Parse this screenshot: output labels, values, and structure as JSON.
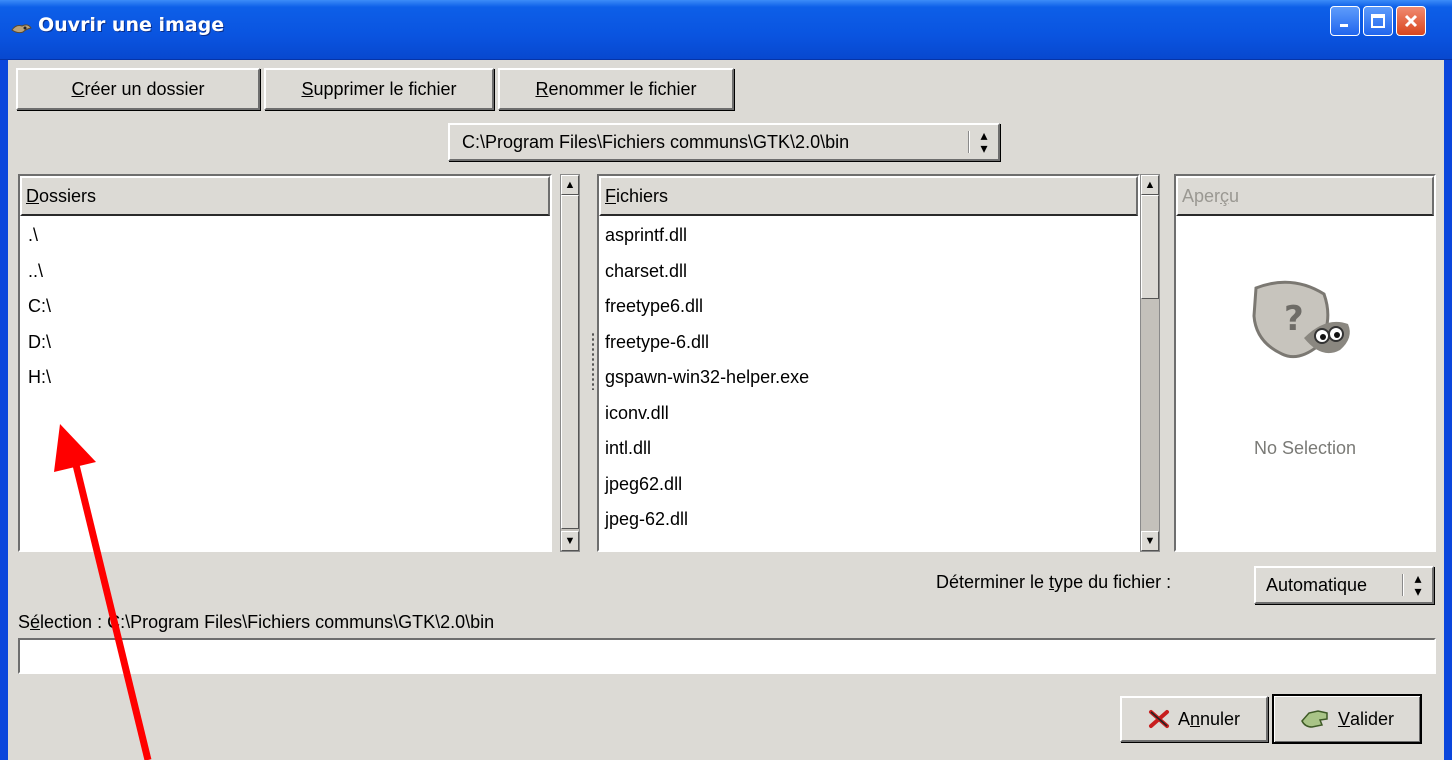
{
  "window": {
    "title": "Ouvrir une image"
  },
  "toolbar": {
    "create_folder_prefix": "",
    "create_folder_mnemonic": "C",
    "create_folder_rest": "réer un dossier",
    "delete_file_mnemonic": "S",
    "delete_file_rest": "upprimer le fichier",
    "rename_file_mnemonic": "R",
    "rename_file_rest": "enommer le fichier"
  },
  "path": {
    "current": "C:\\Program Files\\Fichiers communs\\GTK\\2.0\\bin"
  },
  "folders": {
    "header_mnemonic": "D",
    "header_rest": "ossiers",
    "items": [
      ".\\",
      "..\\",
      "C:\\",
      "D:\\",
      "H:\\"
    ]
  },
  "files": {
    "header_mnemonic": "F",
    "header_rest": "ichiers",
    "items": [
      "asprintf.dll",
      "charset.dll",
      "freetype6.dll",
      "freetype-6.dll",
      "gspawn-win32-helper.exe",
      "iconv.dll",
      "intl.dll",
      "jpeg62.dll",
      "jpeg-62.dll"
    ]
  },
  "preview": {
    "header_prefix": "Aper",
    "header_mnemonic": "ç",
    "header_rest": "u",
    "no_selection": "No Selection",
    "icon": "question-mark-wilber-icon"
  },
  "file_type": {
    "label_prefix": "Déterminer le ",
    "label_mnemonic": "t",
    "label_rest": "ype du fichier :",
    "selected": "Automatique"
  },
  "selection": {
    "label_prefix": "S",
    "label_mnemonic": "é",
    "label_rest": "lection : C:\\Program Files\\Fichiers communs\\GTK\\2.0\\bin",
    "value": ""
  },
  "actions": {
    "cancel_prefix": "A",
    "cancel_mnemonic": "n",
    "cancel_rest": "nuler",
    "ok_mnemonic": "V",
    "ok_rest": "alider"
  },
  "colors": {
    "titlebar": "#0a54e0",
    "dialog_bg": "#dcdad5",
    "annotation_arrow": "#ff0000"
  }
}
